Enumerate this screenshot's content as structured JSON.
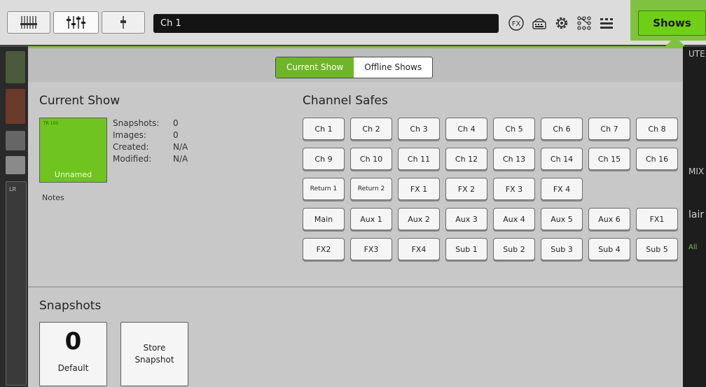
{
  "toolbar": {
    "channel_name": "Ch 1",
    "shows_label": "Shows",
    "fx_label": "FX",
    "icons": [
      "mixer-overview-icon",
      "channel-strip-icon",
      "fader-icon",
      "fx-icon",
      "usb-recorder-icon",
      "settings-gear-icon",
      "patching-icon",
      "meters-icon"
    ]
  },
  "panel": {
    "tabs": [
      {
        "label": "Current Show",
        "active": true
      },
      {
        "label": "Offline Shows",
        "active": false
      }
    ],
    "current_show": {
      "title": "Current Show",
      "thumb_name": "Unnamed",
      "thumb_tag": "TR 100",
      "fields": [
        {
          "label": "Snapshots:",
          "value": "0"
        },
        {
          "label": "Images:",
          "value": "0"
        },
        {
          "label": "Created:",
          "value": "N/A"
        },
        {
          "label": "Modified:",
          "value": "N/A"
        }
      ],
      "notes_label": "Notes"
    },
    "channel_safes": {
      "title": "Channel Safes",
      "buttons": [
        "Ch 1",
        "Ch 2",
        "Ch 3",
        "Ch 4",
        "Ch 5",
        "Ch 6",
        "Ch 7",
        "Ch 8",
        "Ch 9",
        "Ch 10",
        "Ch 11",
        "Ch 12",
        "Ch 13",
        "Ch 14",
        "Ch 15",
        "Ch 16",
        "Return 1",
        "Return 2",
        "FX 1",
        "FX 2",
        "FX 3",
        "FX 4",
        "",
        "",
        "Main",
        "Aux 1",
        "Aux 2",
        "Aux 3",
        "Aux 4",
        "Aux 5",
        "Aux 6",
        "FX1",
        "FX2",
        "FX3",
        "FX4",
        "Sub 1",
        "Sub 2",
        "Sub 3",
        "Sub 4",
        "Sub 5"
      ]
    },
    "snapshots": {
      "title": "Snapshots",
      "default_count": "0",
      "default_label": "Default",
      "store_label": "Store Snapshot"
    }
  },
  "background": {
    "right_labels": [
      "UTE",
      "MIX",
      "lair",
      "All"
    ],
    "left_label": "LR"
  },
  "colors": {
    "accent_green": "#6fcf16",
    "panel_bg": "#c8c8c8"
  }
}
